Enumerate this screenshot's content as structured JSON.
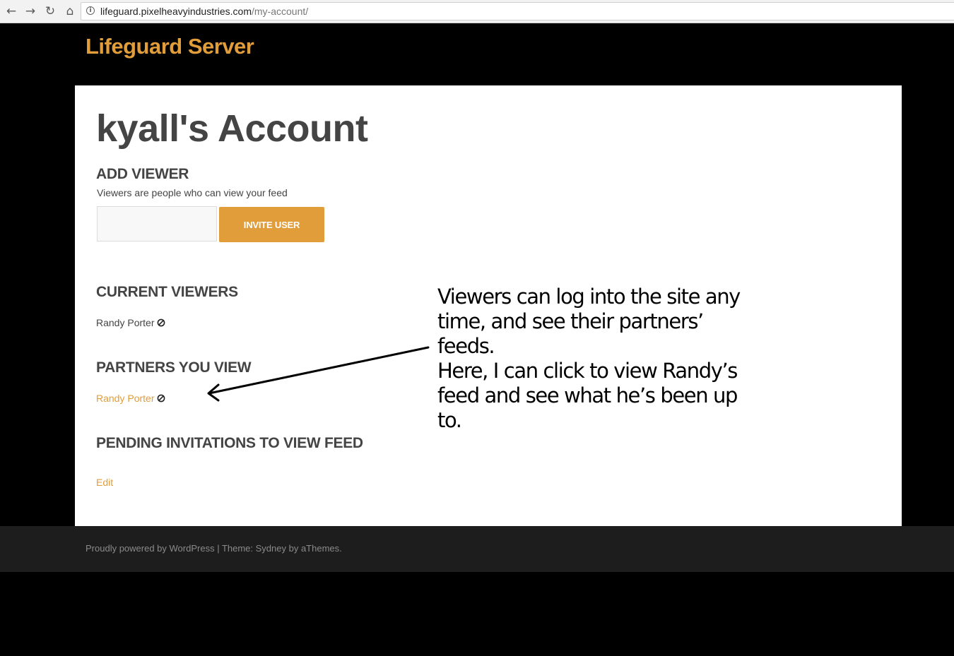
{
  "browser": {
    "back_icon": "←",
    "forward_icon": "→",
    "reload_icon": "↻",
    "home_icon": "⌂",
    "url_host": "lifeguard.pixelheavyindustries.com",
    "url_path": "/my-account/"
  },
  "site": {
    "title": "Lifeguard Server"
  },
  "page": {
    "title": "kyall's Account"
  },
  "add_viewer": {
    "heading": "ADD VIEWER",
    "description": "Viewers are people who can view your feed",
    "input_value": "",
    "button_label": "INVITE USER"
  },
  "current_viewers": {
    "heading": "CURRENT VIEWERS",
    "items": [
      {
        "name": "Randy Porter"
      }
    ]
  },
  "partners": {
    "heading": "PARTNERS YOU VIEW",
    "items": [
      {
        "name": "Randy Porter"
      }
    ]
  },
  "pending": {
    "heading": "PENDING INVITATIONS TO VIEW FEED"
  },
  "edit_label": "Edit",
  "annotation": {
    "lines": [
      "Viewers can log into the site any",
      "time, and see their partners’ feeds.",
      "Here, I can click to view Randy’s",
      "feed and see what he’s been up to."
    ]
  },
  "footer": {
    "powered_label": "Proudly powered by WordPress",
    "separator": " | ",
    "theme_label": "Theme: Sydney by aThemes."
  },
  "colors": {
    "accent": "#e19d3a",
    "text": "#444444",
    "background": "#000000",
    "footer_bg": "#1d1d1d"
  }
}
